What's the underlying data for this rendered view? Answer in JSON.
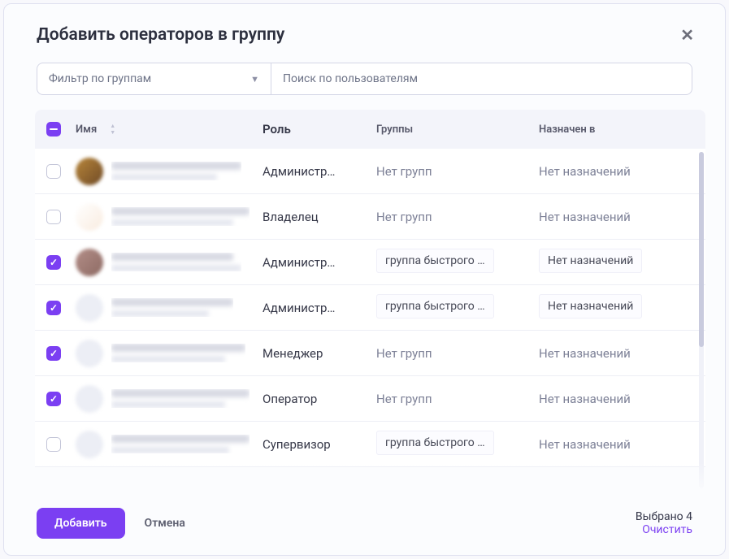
{
  "title": "Добавить операторов в группу",
  "filters": {
    "group_dropdown": "Фильтр по группам",
    "search_placeholder": "Поиск по пользователям"
  },
  "columns": {
    "name": "Имя",
    "role": "Роль",
    "groups": "Группы",
    "assigned": "Назначен в"
  },
  "strings": {
    "no_groups": "Нет групп",
    "no_assign": "Нет назначений",
    "group_chip": "группа быстрого …"
  },
  "rows": [
    {
      "checked": false,
      "avatar": "a1",
      "name_w": 160,
      "sub_w": 130,
      "role": "Администр…",
      "groups": "none",
      "assigned": "none"
    },
    {
      "checked": false,
      "avatar": "a2",
      "name_w": 170,
      "sub_w": 150,
      "role": "Владелец",
      "groups": "none",
      "assigned": "none"
    },
    {
      "checked": true,
      "avatar": "a3",
      "name_w": 150,
      "sub_w": 160,
      "role": "Администр…",
      "groups": "chip",
      "assigned": "chip"
    },
    {
      "checked": true,
      "avatar": "a4",
      "name_w": 150,
      "sub_w": 120,
      "role": "Администр…",
      "groups": "chip",
      "assigned": "chip"
    },
    {
      "checked": true,
      "avatar": "a5",
      "name_w": 165,
      "sub_w": 140,
      "role": "Менеджер",
      "groups": "none",
      "assigned": "none"
    },
    {
      "checked": true,
      "avatar": "a6",
      "name_w": 170,
      "sub_w": 140,
      "role": "Оператор",
      "groups": "none",
      "assigned": "none"
    },
    {
      "checked": false,
      "avatar": "a7",
      "name_w": 170,
      "sub_w": 145,
      "role": "Супервизор",
      "groups": "chip",
      "assigned": "none"
    }
  ],
  "footer": {
    "add": "Добавить",
    "cancel": "Отмена",
    "selected": "Выбрано 4",
    "clear": "Очистить"
  }
}
